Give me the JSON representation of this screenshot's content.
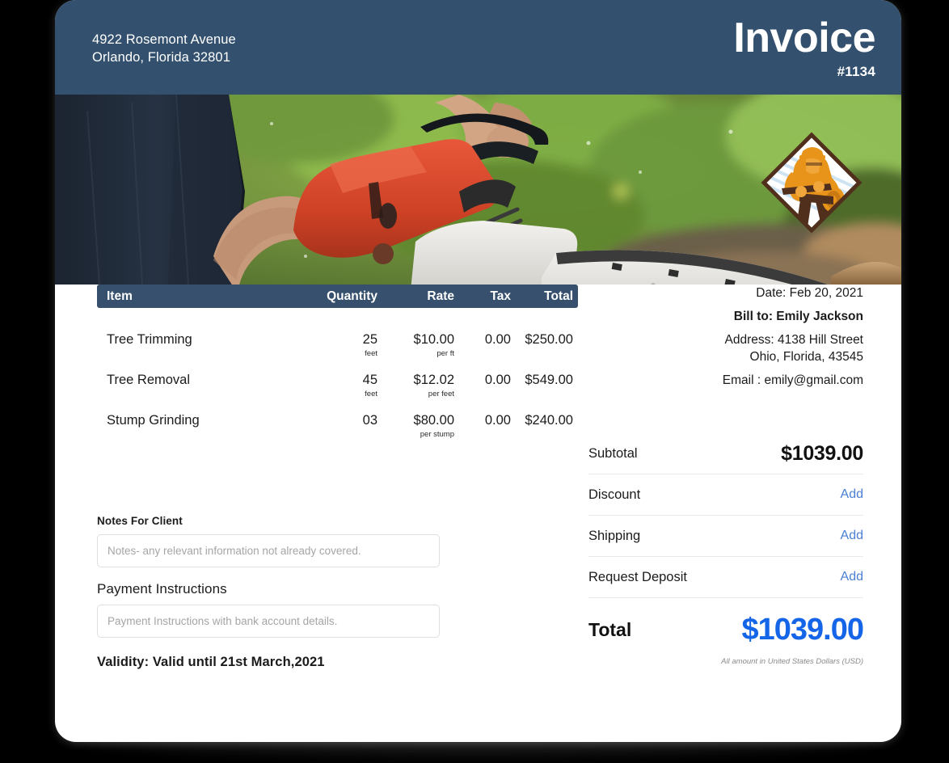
{
  "header": {
    "address_line1": "4922 Rosemont Avenue",
    "address_line2": "Orlando, Florida 32801",
    "title": "Invoice",
    "number": "#1134"
  },
  "hero": {
    "logo_name": "lumberjack-diamond-logo",
    "photo_description": "worker cutting log with chainsaw"
  },
  "table": {
    "columns": {
      "item": "Item",
      "quantity": "Quantity",
      "rate": "Rate",
      "tax": "Tax",
      "total": "Total"
    },
    "rows": [
      {
        "item": "Tree Trimming",
        "quantity": "25",
        "quantity_unit": "feet",
        "rate": "$10.00",
        "rate_unit": "per ft",
        "tax": "0.00",
        "total": "$250.00"
      },
      {
        "item": "Tree Removal",
        "quantity": "45",
        "quantity_unit": "feet",
        "rate": "$12.02",
        "rate_unit": "per feet",
        "tax": "0.00",
        "total": "$549.00"
      },
      {
        "item": "Stump Grinding",
        "quantity": "03",
        "quantity_unit": "",
        "rate": "$80.00",
        "rate_unit": "per stump",
        "tax": "0.00",
        "total": "$240.00"
      }
    ]
  },
  "notes": {
    "notes_label": "Notes For Client",
    "notes_placeholder": "Notes- any relevant information not already covered.",
    "notes_value": "",
    "payment_label": "Payment Instructions",
    "payment_placeholder": "Payment Instructions with bank account details.",
    "payment_value": "",
    "validity": "Validity: Valid until 21st March,2021"
  },
  "billing": {
    "date": "Date: Feb 20, 2021",
    "bill_to": "Bill to: Emily Jackson",
    "address_line1": "Address: 4138 Hill Street",
    "address_line2": "Ohio, Florida, 43545",
    "email": "Email : emily@gmail.com"
  },
  "totals": {
    "subtotal_label": "Subtotal",
    "subtotal_value": "$1039.00",
    "discount_label": "Discount",
    "discount_action": "Add",
    "shipping_label": "Shipping",
    "shipping_action": "Add",
    "deposit_label": "Request Deposit",
    "deposit_action": "Add",
    "total_label": "Total",
    "total_value": "$1039.00",
    "currency_note": "All amount in United States Dollars (USD)"
  },
  "colors": {
    "header_blue": "#33516e",
    "table_header_blue": "#37506e",
    "link_blue": "#4a7fd4",
    "total_blue": "#1565e8",
    "logo_orange": "#e8941a",
    "logo_brown": "#50301c"
  }
}
